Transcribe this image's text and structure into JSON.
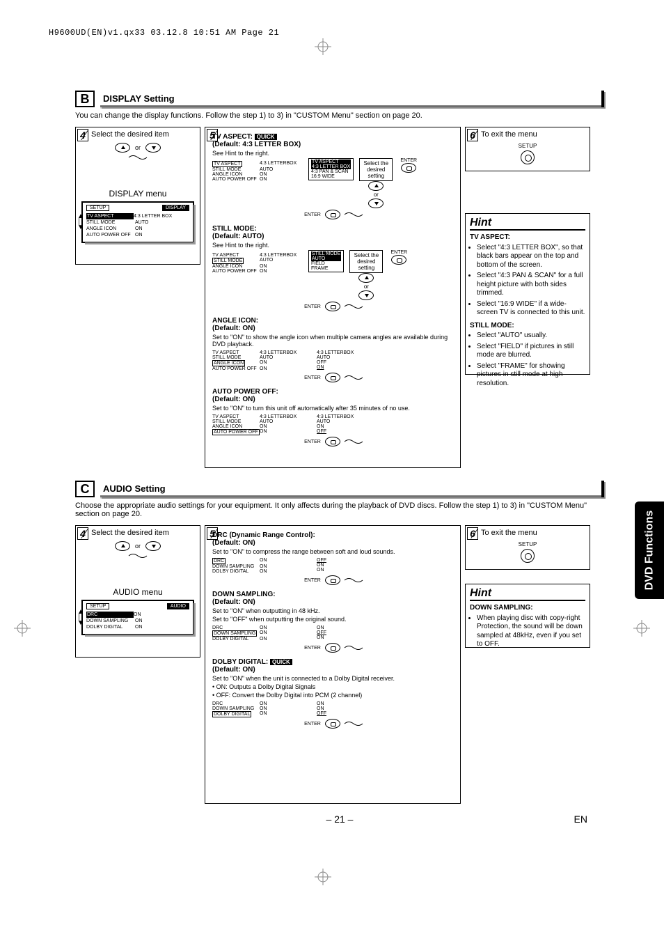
{
  "print_header": "H9600UD(EN)v1.qx33  03.12.8  10:51 AM  Page 21",
  "page_number": "– 21 –",
  "lang_code": "EN",
  "side_tab": "DVD Functions",
  "sections": {
    "b": {
      "letter": "B",
      "title": "DISPLAY Setting",
      "intro": "You can change the display functions. Follow the step 1) to 3) in \"CUSTOM Menu\" section on page 20.",
      "step4": {
        "num": "4",
        "title": "Select the desired item",
        "or": "or",
        "menu_label": "DISPLAY menu",
        "menu_top_left": "SETUP",
        "menu_top_right": "DISPLAY",
        "rows": [
          {
            "c1": "TV ASPECT",
            "c2": "4:3 LETTER BOX",
            "selected": true
          },
          {
            "c1": "STILL MODE",
            "c2": "AUTO"
          },
          {
            "c1": "ANGLE ICON",
            "c2": "ON"
          },
          {
            "c1": "AUTO POWER OFF",
            "c2": "ON"
          }
        ]
      },
      "step5": {
        "num": "5",
        "tv_aspect": {
          "label": "TV ASPECT:",
          "quick": "QUICK",
          "default": "(Default: 4:3 LETTER BOX)",
          "desc": "See Hint to the right.",
          "opts_title": "TV ASPECT",
          "opts": [
            "4:3 LETTER BOX",
            "4:3 PAN & SCAN",
            "16:9 WIDE"
          ],
          "select_label": "Select the desired setting",
          "enter": "ENTER",
          "or": "or"
        },
        "still_mode": {
          "label": "STILL MODE:",
          "default": "(Default: AUTO)",
          "desc": "See Hint to the right.",
          "opts_title": "STILL MODE",
          "opts": [
            "AUTO",
            "FIELD",
            "FRAME"
          ],
          "select_label": "Select the desired setting",
          "enter": "ENTER",
          "or": "or"
        },
        "angle_icon": {
          "label": "ANGLE ICON:",
          "default": "(Default: ON)",
          "desc": "Set to \"ON\" to show the angle icon when multiple camera angles are available during DVD playback.",
          "opts": [
            "4:3 LETTERBOX",
            "AUTO",
            "OFF",
            "ON"
          ],
          "enter": "ENTER"
        },
        "auto_power": {
          "label": "AUTO POWER OFF:",
          "default": "(Default: ON)",
          "desc": "Set to \"ON\" to turn this unit off automatically after 35 minutes of no use.",
          "opts": [
            "4:3 LETTERBOX",
            "AUTO",
            "ON",
            "OFF"
          ],
          "enter": "ENTER"
        },
        "menu_rows_common": [
          {
            "c1": "TV ASPECT",
            "c2": "4:3 LETTERBOX"
          },
          {
            "c1": "STILL MODE",
            "c2": "AUTO"
          },
          {
            "c1": "ANGLE ICON",
            "c2": "ON"
          },
          {
            "c1": "AUTO POWER OFF",
            "c2": "ON"
          }
        ]
      },
      "step6": {
        "num": "6",
        "title": "To exit the menu",
        "setup": "SETUP"
      },
      "hint": {
        "title": "Hint",
        "tv_aspect_hd": "TV ASPECT:",
        "tv_items": [
          "Select \"4:3 LETTER BOX\", so that black bars appear on the top and bottom of the screen.",
          "Select \"4:3 PAN & SCAN\" for a full height picture with both sides trimmed.",
          "Select \"16:9 WIDE\" if a wide-screen TV is connected to this unit."
        ],
        "still_hd": "STILL MODE:",
        "still_items": [
          "Select \"AUTO\" usually.",
          "Select \"FIELD\" if pictures in still mode are blurred.",
          "Select \"FRAME\" for showing pictures in still mode at high resolution."
        ]
      }
    },
    "c": {
      "letter": "C",
      "title": "AUDIO Setting",
      "intro": "Choose the appropriate audio settings for your equipment. It only affects during the playback of DVD discs. Follow the step 1) to 3) in \"CUSTOM Menu\" section on page 20.",
      "step4": {
        "num": "4",
        "title": "Select the desired item",
        "or": "or",
        "menu_label": "AUDIO menu",
        "menu_top_left": "SETUP",
        "menu_top_right": "AUDIO",
        "rows": [
          {
            "c1": "DRC",
            "c2": "ON",
            "selected": true
          },
          {
            "c1": "DOWN SAMPLING",
            "c2": "ON"
          },
          {
            "c1": "DOLBY DIGITAL",
            "c2": "ON"
          }
        ]
      },
      "step5": {
        "num": "5",
        "drc": {
          "label": "DRC (Dynamic Range Control):",
          "default": "(Default: ON)",
          "desc": "Set to \"ON\" to compress the range between soft and loud sounds.",
          "opts": [
            "OFF",
            "ON",
            "ON"
          ],
          "enter": "ENTER"
        },
        "down_sampling": {
          "label": "DOWN SAMPLING:",
          "default": "(Default: ON)",
          "desc1": "Set to \"ON\" when outputting in 48 kHz.",
          "desc2": "Set to \"OFF\" when outputting the original sound.",
          "opts": [
            "ON",
            "OFF",
            "ON"
          ],
          "enter": "ENTER"
        },
        "dolby": {
          "label": "DOLBY DIGITAL:",
          "quick": "QUICK",
          "default": "(Default: ON)",
          "desc": "Set to \"ON\" when the unit is connected to a Dolby Digital receiver.",
          "b1": "• ON: Outputs a Dolby Digital Signals",
          "b2": "• OFF: Convert the Dolby Digital into PCM (2 channel)",
          "opts": [
            "ON",
            "ON",
            "OFF"
          ],
          "enter": "ENTER"
        },
        "menu_rows_common": [
          {
            "c1": "DRC",
            "c2": "ON"
          },
          {
            "c1": "DOWN SAMPLING",
            "c2": "ON"
          },
          {
            "c1": "DOLBY DIGITAL",
            "c2": "ON"
          }
        ]
      },
      "step6": {
        "num": "6",
        "title": "To exit the menu",
        "setup": "SETUP"
      },
      "hint": {
        "title": "Hint",
        "ds_hd": "DOWN SAMPLING:",
        "ds_items": [
          "When playing disc with copy-right Protection, the sound will be down sampled at 48kHz, even if you set to OFF."
        ]
      }
    }
  }
}
